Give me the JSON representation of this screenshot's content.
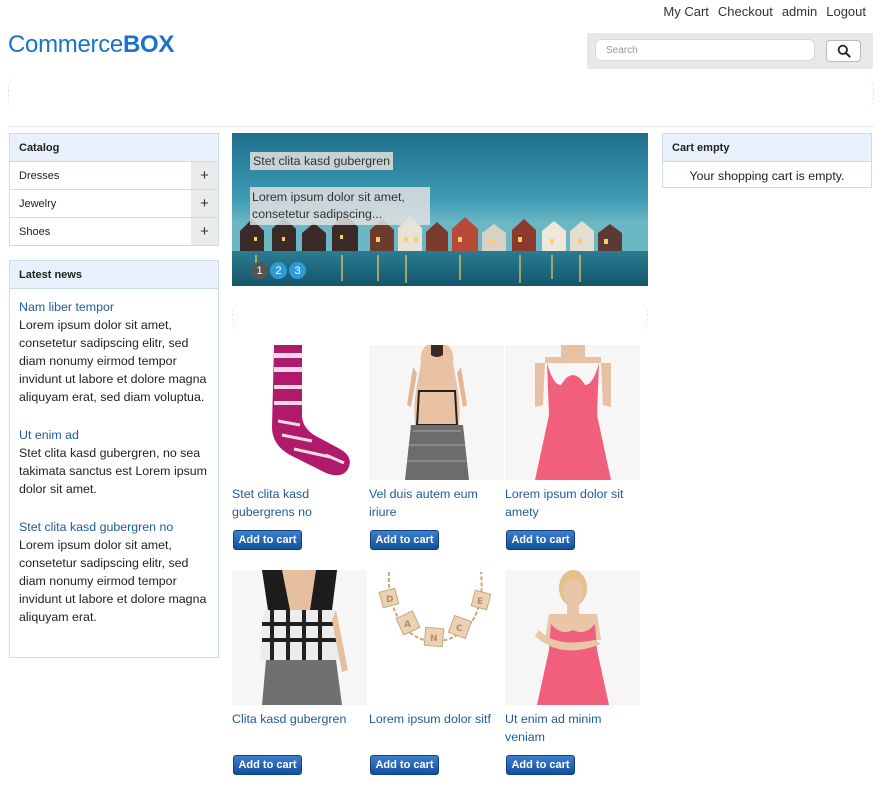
{
  "header": {
    "links": [
      "My Cart",
      "Checkout",
      "admin",
      "Logout"
    ],
    "logo_light": "Commerce",
    "logo_bold": "BOX",
    "search_placeholder": "Search",
    "search_icon": "magnifier-icon"
  },
  "catalog": {
    "title": "Catalog",
    "items": [
      {
        "label": "Dresses",
        "expand": "+"
      },
      {
        "label": "Jewelry",
        "expand": "+"
      },
      {
        "label": "Shoes",
        "expand": "+"
      }
    ]
  },
  "news": {
    "title": "Latest news",
    "items": [
      {
        "title": "Nam liber tempor",
        "text": "Lorem ipsum dolor sit amet, consetetur sadipscing elitr, sed diam nonumy eirmod tempor invidunt ut labore et dolore magna aliquyam erat, sed diam voluptua."
      },
      {
        "title": "Ut enim ad",
        "text": "Stet clita kasd gubergren, no sea takimata sanctus est Lorem ipsum dolor sit amet."
      },
      {
        "title": "Stet clita kasd gubergren no",
        "text": "Lorem ipsum dolor sit amet, consetetur sadipscing elitr, sed diam nonumy eirmod tempor invidunt ut labore et dolore magna aliquyam erat."
      }
    ]
  },
  "cart": {
    "title": "Cart empty",
    "text": "Your shopping cart is empty."
  },
  "slider": {
    "caption_title": "Stet clita kasd gubergren",
    "caption_text": "Lorem ipsum dolor sit amet, consetetur sadipscing...",
    "pages": [
      "1",
      "2",
      "3"
    ]
  },
  "products": [
    {
      "name": "Stet clita kasd gubergrens no",
      "button": "Add to cart"
    },
    {
      "name": "Vel duis autem eum iriure",
      "button": "Add to cart"
    },
    {
      "name": "Lorem ipsum dolor sit amety",
      "button": "Add to cart"
    },
    {
      "name": "Clita kasd gubergren",
      "button": "Add to cart"
    },
    {
      "name": "Lorem ipsum dolor sitf",
      "button": "Add to cart"
    },
    {
      "name": "Ut enim ad minim veniam",
      "button": "Add to cart"
    }
  ],
  "colors": {
    "brand": "#1a73c8",
    "link": "#1f5a9a",
    "box_header": "#e8f1fb",
    "active_dot": "#2d9bd6"
  }
}
